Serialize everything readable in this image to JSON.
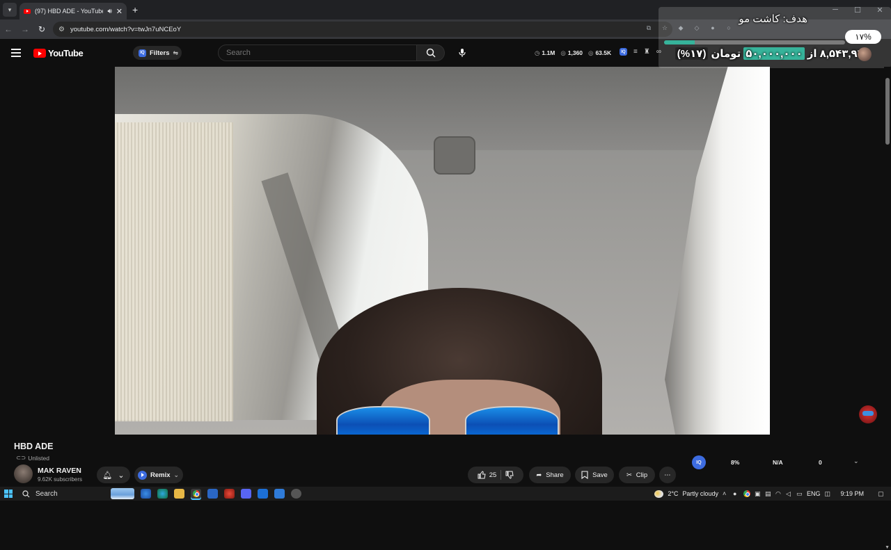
{
  "browser": {
    "tab": {
      "title": "(97) HBD ADE - YouTube"
    },
    "url": "youtube.com/watch?v=twJn7uNCEoY"
  },
  "youtube": {
    "logo_text": "YouTube",
    "filters_label": "Filters",
    "search": {
      "placeholder": "Search"
    },
    "stats": {
      "views": "1.1M",
      "likes": "1,360",
      "subs": "63.5K"
    }
  },
  "overlay": {
    "goal_text": "هدف: کاشت مو",
    "percent_text": "۱۷%",
    "progress_fraction": 0.17,
    "raised": "۸,۵۴۳,۹۴۱",
    "of_word": "از",
    "target": "۵۰,۰۰۰,۰۰۰",
    "currency": "تومان",
    "percent_paren": "(%۱۷)",
    "accent_color": "#36b39a"
  },
  "video": {
    "title": "HBD ADE",
    "visibility": "Unlisted",
    "channel": {
      "name": "MAK RAVEN",
      "subscribers": "9.62K subscribers"
    },
    "actions": {
      "remix": "Remix",
      "likes": "25",
      "share": "Share",
      "save": "Save",
      "clip": "Clip"
    }
  },
  "iq_panel": {
    "badge": "IQ",
    "percent": "8%",
    "na": "N/A",
    "count": "0"
  },
  "taskbar": {
    "search_label": "Search",
    "weather": "2°C",
    "weather_desc": "Partly cloudy",
    "language": "ENG",
    "time": "9:19 PM"
  }
}
